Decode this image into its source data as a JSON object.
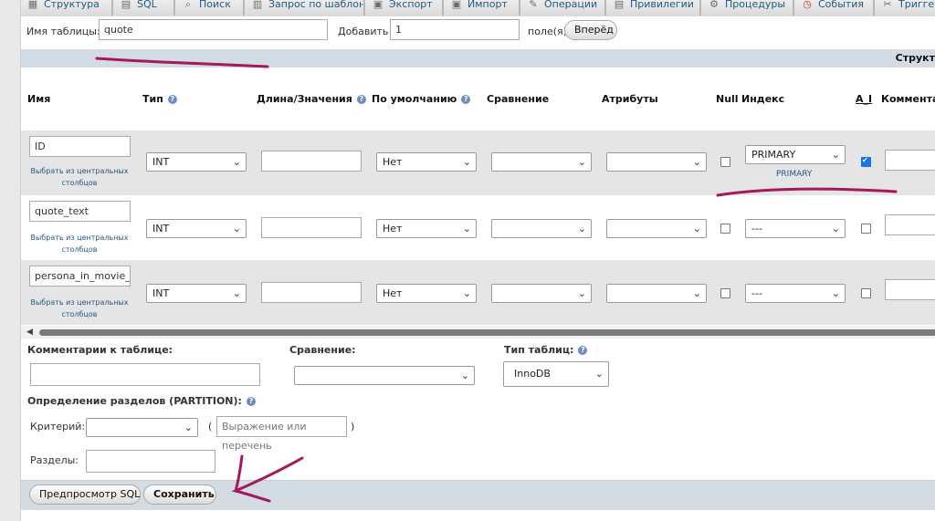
{
  "tabs": [
    {
      "label": "Структура",
      "icon": "table-icon"
    },
    {
      "label": "SQL",
      "icon": "sql-icon"
    },
    {
      "label": "Поиск",
      "icon": "search-icon"
    },
    {
      "label": "Запрос по шаблону",
      "icon": "query-icon"
    },
    {
      "label": "Экспорт",
      "icon": "export-icon"
    },
    {
      "label": "Импорт",
      "icon": "import-icon"
    },
    {
      "label": "Операции",
      "icon": "wrench-icon"
    },
    {
      "label": "Привилегии",
      "icon": "privileges-icon"
    },
    {
      "label": "Процедуры",
      "icon": "routines-icon"
    },
    {
      "label": "События",
      "icon": "clock-icon"
    },
    {
      "label": "Тригге",
      "icon": "triggers-icon"
    }
  ],
  "top": {
    "table_name_label": "Имя таблицы:",
    "table_name_value": "quote",
    "add_label": "Добавить",
    "add_value": "1",
    "columns_label": "поле(я)",
    "go_button": "Вперёд"
  },
  "band_label": "Структ",
  "headers": {
    "name": "Имя",
    "type": "Тип",
    "length": "Длина/Значения",
    "default": "По умолчанию",
    "collation": "Сравнение",
    "attributes": "Атрибуты",
    "null": "Null",
    "index": "Индекс",
    "ai": "A_I",
    "comments": "Комментар"
  },
  "pick_central_line1": "Выбрать из центральных",
  "pick_central_line2": "столбцов",
  "rows": [
    {
      "name": "ID",
      "type": "INT",
      "default": "Нет",
      "index": "PRIMARY",
      "index_note": "PRIMARY",
      "ai": true
    },
    {
      "name": "quote_text",
      "type": "INT",
      "default": "Нет",
      "index": "---",
      "index_note": "",
      "ai": false
    },
    {
      "name": "persona_in_movie_id",
      "type": "INT",
      "default": "Нет",
      "index": "---",
      "index_note": "",
      "ai": false
    }
  ],
  "bottom": {
    "table_comments_label": "Комментарии к таблице:",
    "collation_label": "Сравнение:",
    "engine_label": "Тип таблиц:",
    "engine_value": "InnoDB",
    "partition_label": "Определение разделов (PARTITION):",
    "criteria_label": "Критерий:",
    "paren_open": "(",
    "paren_close": ")",
    "expression_placeholder": "Выражение или перечень",
    "partitions_label": "Разделы:",
    "preview_sql_button": "Предпросмотр SQL",
    "save_button": "Сохранить"
  },
  "colors": {
    "annotation": "#a3195b",
    "band": "#d3dce3",
    "link": "#235a81"
  }
}
